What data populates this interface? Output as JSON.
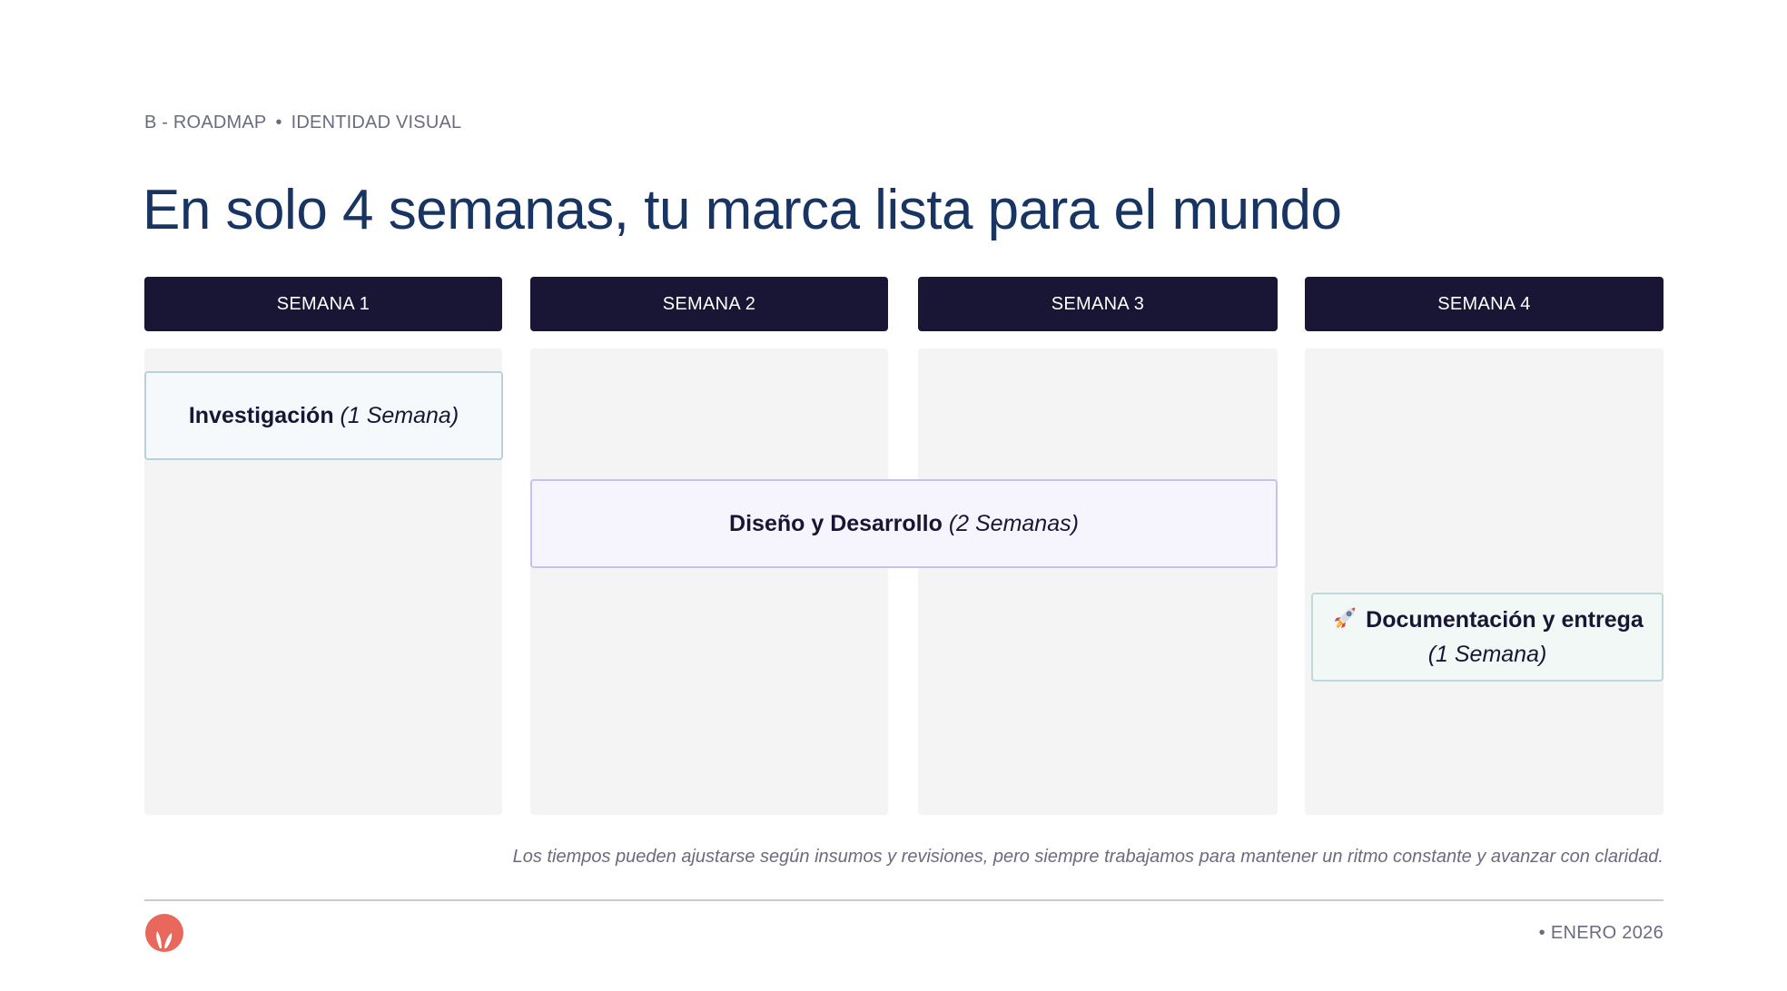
{
  "breadcrumb": {
    "section": "B - ROADMAP",
    "separator": "•",
    "topic": "IDENTIDAD VISUAL"
  },
  "title": "En solo 4 semanas, tu marca lista para el mundo",
  "weeks": [
    {
      "label": "SEMANA 1"
    },
    {
      "label": "SEMANA 2"
    },
    {
      "label": "SEMANA 3"
    },
    {
      "label": "SEMANA 4"
    }
  ],
  "tasks": [
    {
      "title": "Investigación",
      "duration": "(1 Semana)",
      "icon": ""
    },
    {
      "title": "Diseño y Desarrollo",
      "duration": "(2 Semanas)",
      "icon": ""
    },
    {
      "title": "Documentación y entrega",
      "duration": "(1 Semana)",
      "icon": "rocket-icon"
    }
  ],
  "footnote": "Los tiempos pueden ajustarse según insumos y revisiones, pero siempre trabajamos para mantener un ritmo constante y avanzar con claridad.",
  "footer": {
    "date": "• ENERO 2026"
  },
  "colors": {
    "title": "#173463",
    "header_bg": "#191535",
    "column_bg": "#f3f4f3",
    "logo": "#e8695c",
    "research_border": "#bcd0dc",
    "design_border": "#c7c1ec",
    "docs_border": "#c0d8d9"
  }
}
